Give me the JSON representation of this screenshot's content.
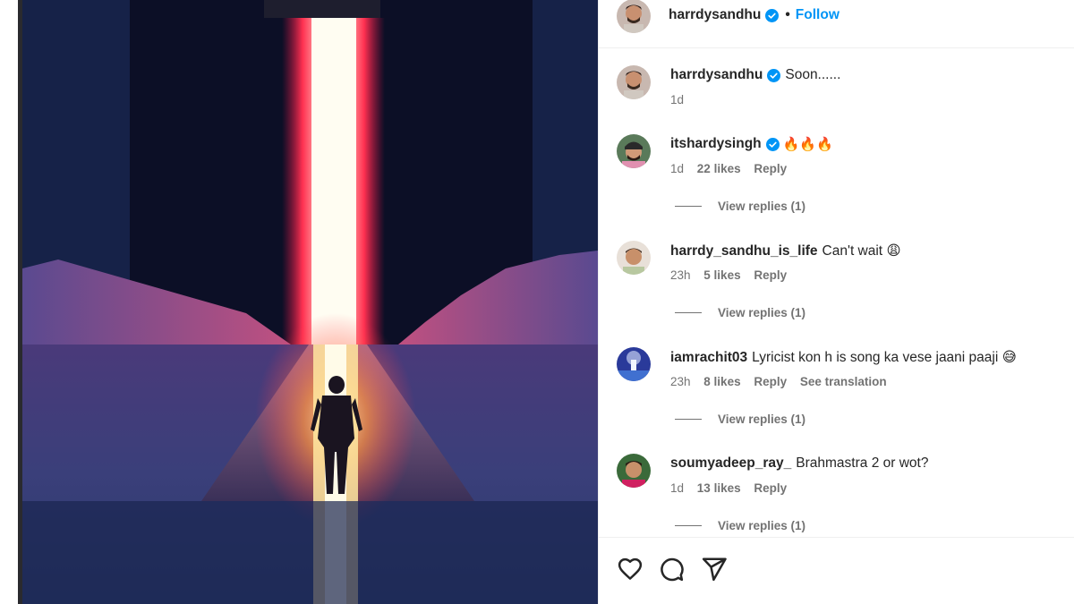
{
  "post": {
    "author": "harrdysandhu",
    "follow_label": "Follow",
    "dot": "•"
  },
  "comments": [
    {
      "user": "harrdysandhu",
      "verified": true,
      "text": "Soon......",
      "time": "1d",
      "likes": "",
      "reply": "",
      "translation": "",
      "replies": ""
    },
    {
      "user": "itshardysingh",
      "verified": true,
      "text": "🔥🔥🔥",
      "time": "1d",
      "likes": "22 likes",
      "reply": "Reply",
      "translation": "",
      "replies": "View replies (1)"
    },
    {
      "user": "harrdy_sandhu_is_life",
      "verified": false,
      "text": "Can't wait 😩",
      "time": "23h",
      "likes": "5 likes",
      "reply": "Reply",
      "translation": "",
      "replies": "View replies (1)"
    },
    {
      "user": "iamrachit03",
      "verified": false,
      "text": "Lyricist kon h is song ka vese jaani paaji 😅",
      "time": "23h",
      "likes": "8 likes",
      "reply": "Reply",
      "translation": "See translation",
      "replies": "View replies (1)"
    },
    {
      "user": "soumyadeep_ray_",
      "verified": false,
      "text": "Brahmastra 2 or wot?",
      "time": "1d",
      "likes": "13 likes",
      "reply": "Reply",
      "translation": "",
      "replies": "View replies (1)"
    }
  ],
  "actions": {
    "icons": [
      "heart-icon",
      "comment-icon",
      "share-icon"
    ]
  },
  "colors": {
    "accent": "#0095f6",
    "verified": "#0095f6",
    "text": "#262626",
    "muted": "#737373"
  }
}
